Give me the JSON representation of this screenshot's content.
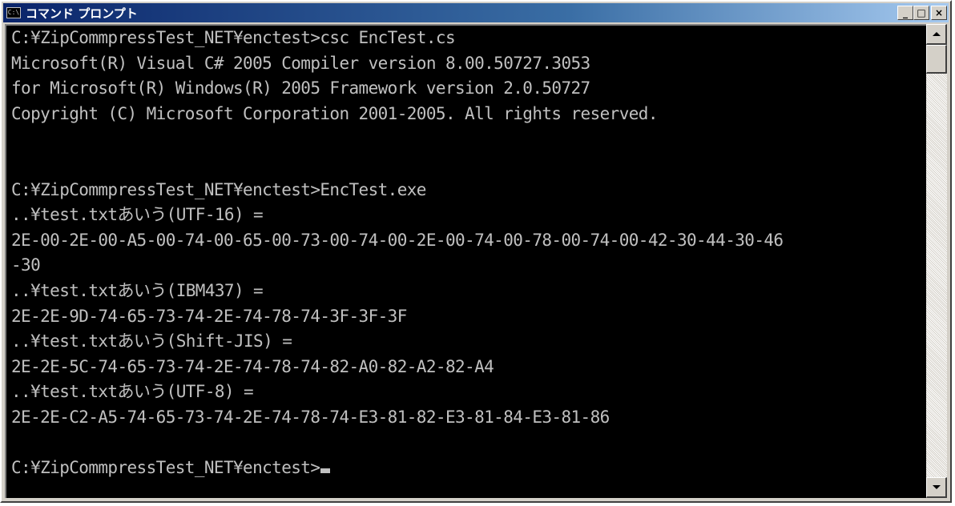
{
  "window": {
    "title": "コマンド プロンプト",
    "icon": "cmd-icon",
    "buttons": {
      "minimize": "_",
      "maximize": "□",
      "close": "×"
    }
  },
  "console": {
    "lines": [
      "C:¥ZipCommpressTest_NET¥enctest>csc EncTest.cs",
      "Microsoft(R) Visual C# 2005 Compiler version 8.00.50727.3053",
      "for Microsoft(R) Windows(R) 2005 Framework version 2.0.50727",
      "Copyright (C) Microsoft Corporation 2001-2005. All rights reserved.",
      "",
      "",
      "C:¥ZipCommpressTest_NET¥enctest>EncTest.exe",
      "..¥test.txtあいう(UTF-16) =",
      "2E-00-2E-00-A5-00-74-00-65-00-73-00-74-00-2E-00-74-00-78-00-74-00-42-30-44-30-46",
      "-30",
      "..¥test.txtあいう(IBM437) =",
      "2E-2E-9D-74-65-73-74-2E-74-78-74-3F-3F-3F",
      "..¥test.txtあいう(Shift-JIS) =",
      "2E-2E-5C-74-65-73-74-2E-74-78-74-82-A0-82-A2-82-A4",
      "..¥test.txtあいう(UTF-8) =",
      "2E-2E-C2-A5-74-65-73-74-2E-74-78-74-E3-81-82-E3-81-84-E3-81-86",
      "",
      "C:¥ZipCommpressTest_NET¥enctest>"
    ]
  },
  "colors": {
    "console_bg": "#000000",
    "console_fg": "#c0c0c0",
    "titlebar_start": "#0a246a",
    "titlebar_end": "#a6caf0",
    "chrome": "#d4d0c8"
  }
}
